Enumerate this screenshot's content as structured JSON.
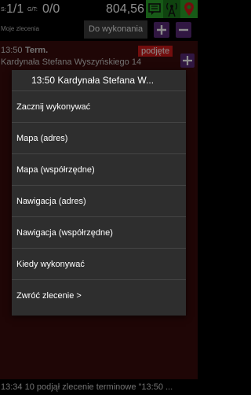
{
  "header": {
    "s_label": "S:",
    "s_value": "1/1",
    "gt_label": "G/T:",
    "gt_value": "0/0",
    "amount": "804,56",
    "subtitle": "Moje zlecenia",
    "filter_value": "Do wykonania"
  },
  "order_row": {
    "time": "13:50",
    "type": "Term.",
    "address": "Kardynała Stefana Wyszyńskiego 14",
    "badge": "podjęte"
  },
  "dialog": {
    "title": "13:50 Kardynała Stefana W...",
    "items": [
      "Zacznij wykonywać",
      "Mapa (adres)",
      "Mapa (współrzędne)",
      "Nawigacja (adres)",
      "Nawigacja (współrzędne)",
      "Kiedy wykonywać",
      "Zwróć zlecenie >"
    ]
  },
  "footer": {
    "text": "13:34  10 podjął zlecenie terminowe \"13:50 ..."
  },
  "colors": {
    "green": "#2aa52a",
    "purple": "#5a2a78",
    "list_bg": "#3a0c0c",
    "badge": "#d21a1a",
    "dialog_bg": "#2e2e2e"
  },
  "icons": [
    "message-icon",
    "antenna-icon",
    "map-pin-icon",
    "plus-icon",
    "minus-icon"
  ]
}
